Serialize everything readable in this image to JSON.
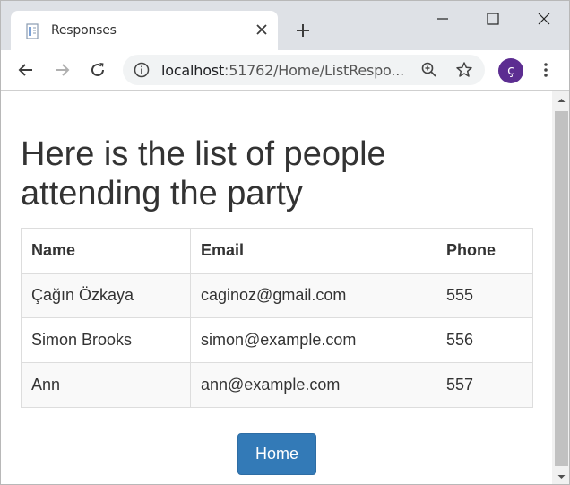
{
  "browser": {
    "tab_title": "Responses",
    "url_host": "localhost",
    "url_rest": ":51762/Home/ListRespo...",
    "profile_initial": "ç"
  },
  "page": {
    "heading": "Here is the list of people attending the party",
    "columns": [
      "Name",
      "Email",
      "Phone"
    ],
    "rows": [
      {
        "name": "Çağın Özkaya",
        "email": "caginoz@gmail.com",
        "phone": "555"
      },
      {
        "name": "Simon Brooks",
        "email": "simon@example.com",
        "phone": "556"
      },
      {
        "name": "Ann",
        "email": "ann@example.com",
        "phone": "557"
      }
    ],
    "home_label": "Home"
  },
  "colors": {
    "button_primary": "#337ab7",
    "avatar": "#5c2d91",
    "tabstrip": "#dee1e6"
  }
}
